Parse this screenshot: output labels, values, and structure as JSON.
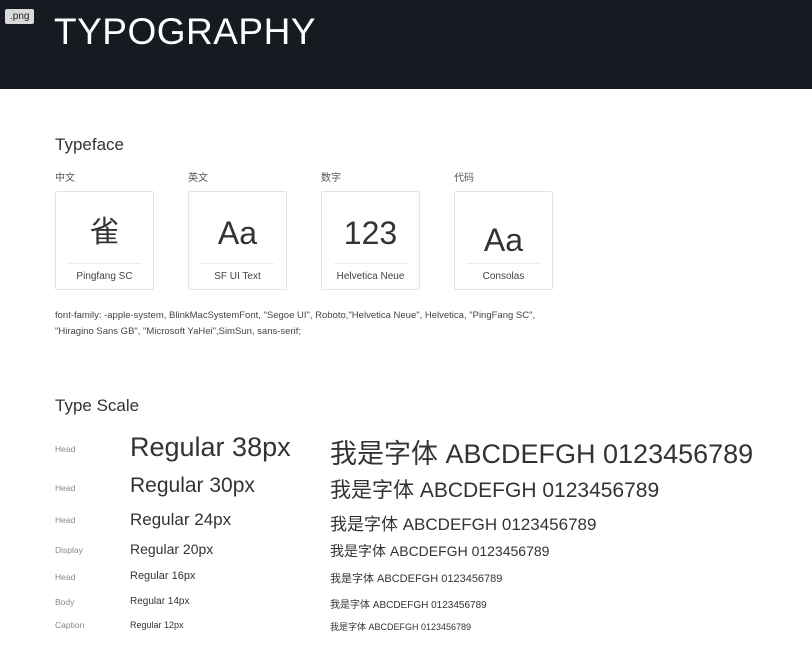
{
  "file_badge": ".png",
  "title": "TYPOGRAPHY",
  "typeface": {
    "heading": "Typeface",
    "faces": [
      {
        "label": "中文",
        "sample": "雀",
        "name": "Pingfang SC"
      },
      {
        "label": "英文",
        "sample": "Aa",
        "name": "SF UI Text"
      },
      {
        "label": "数字",
        "sample": "123",
        "name": "Helvetica Neue"
      },
      {
        "label": "代码",
        "sample": "Aa",
        "name": "Consolas"
      }
    ],
    "font_family_note": "font-family: -apple-system, BlinkMacSystemFont, \"Segoe UI\", Roboto,\"Helvetica Neue\", Helvetica, \"PingFang SC\", \"Hiragino Sans GB\", \"Microsoft YaHei\",SimSun, sans-serif;"
  },
  "type_scale": {
    "heading": "Type Scale",
    "rows": [
      {
        "tag": "Head",
        "name": "Regular 38px",
        "sample": "我是字体 ABCDEFGH 0123456789"
      },
      {
        "tag": "Head",
        "name": "Regular 30px",
        "sample": "我是字体 ABCDEFGH 0123456789"
      },
      {
        "tag": "Head",
        "name": "Regular 24px",
        "sample": "我是字体 ABCDEFGH 0123456789"
      },
      {
        "tag": "Display",
        "name": "Regular 20px",
        "sample": "我是字体 ABCDEFGH 0123456789"
      },
      {
        "tag": "Head",
        "name": "Regular 16px",
        "sample": "我是字体 ABCDEFGH 0123456789"
      },
      {
        "tag": "Body",
        "name": "Regular 14px",
        "sample": "我是字体 ABCDEFGH 0123456789"
      },
      {
        "tag": "Caption",
        "name": "Regular 12px",
        "sample": "我是字体 ABCDEFGH 0123456789"
      }
    ]
  },
  "colors": {
    "header_bg": "#161b22",
    "text": "#333333",
    "muted": "#888888",
    "card_border": "#e1e4e8"
  }
}
